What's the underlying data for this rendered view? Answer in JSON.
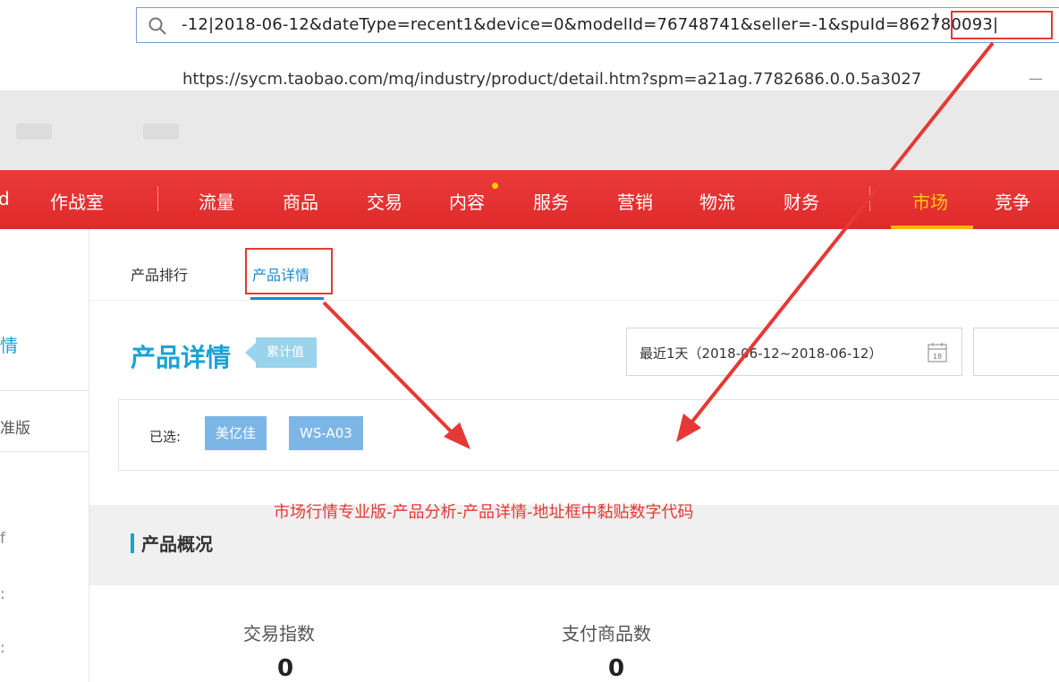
{
  "address_bar": {
    "url_text": "-12|2018-06-12&dateType=recent1&device=0&modelId=76748741&seller=-1&spuId=862780093|",
    "suggestion": "https://sycm.taobao.com/mq/industry/product/detail.htm?spm=a21ag.7782686.0.0.5a3027"
  },
  "top_nav": {
    "items": [
      "作战室",
      "流量",
      "商品",
      "交易",
      "内容",
      "服务",
      "营销",
      "物流",
      "财务",
      "市场",
      "竞争"
    ],
    "active": "市场"
  },
  "sidebar": {
    "items": [
      "情",
      "准版",
      "f",
      ":",
      ":"
    ]
  },
  "sub_tabs": {
    "items": [
      "产品排行",
      "产品详情"
    ],
    "active": "产品详情"
  },
  "page": {
    "title": "产品详情",
    "badge": "累计值",
    "date_range": "最近1天（2018-06-12~2018-06-12）",
    "calendar_day": "18"
  },
  "selected": {
    "label": "已选:",
    "chips": [
      "美亿佳",
      "WS-A03"
    ]
  },
  "annotation": "市场行情专业版-产品分析-产品详情-地址框中黏贴数字代码",
  "overview": {
    "title": "产品概况",
    "metrics": [
      {
        "label": "交易指数",
        "value": "0"
      },
      {
        "label": "支付商品数",
        "value": "0"
      }
    ]
  },
  "colors": {
    "nav_red": "#e53333",
    "accent_blue": "#1b8ad0",
    "annotation_red": "#e53935",
    "chip_blue": "#7cb6e6"
  }
}
